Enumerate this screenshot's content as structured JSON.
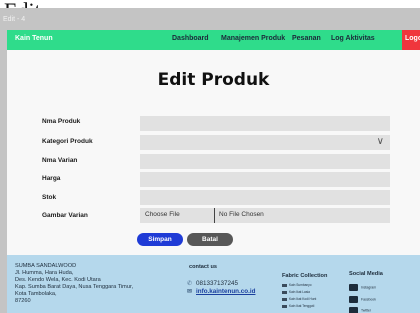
{
  "window": {
    "title": "Edit",
    "frame_label": "Edit - 4"
  },
  "navbar": {
    "brand": "Kain Tenun",
    "items": [
      {
        "label": "Dashboard"
      },
      {
        "label": "Manajemen Produk"
      },
      {
        "label": "Pesanan"
      },
      {
        "label": "Log Aktivitas"
      }
    ],
    "logout": "Logout",
    "accent": "#2fdc8b"
  },
  "page": {
    "title": "Edit Produk",
    "fields": [
      {
        "label": "Nma Produk",
        "value": ""
      },
      {
        "label": "Kategori Produk",
        "value": ""
      },
      {
        "label": "Nma Varian",
        "value": ""
      },
      {
        "label": "Harga",
        "value": ""
      },
      {
        "label": "Stok",
        "value": ""
      }
    ],
    "variant_image": {
      "label": "Gambar Varian",
      "button": "Choose File",
      "filename": "No File Chosen"
    },
    "save_label": "Simpan",
    "cancel_label": "Batal"
  },
  "footer": {
    "address": [
      "SUMBA SANDALWOOD",
      "Jl. Humma, Hara Huda,",
      "Des. Kendo Wela, Kec. Kodi Utara",
      "Kap. Sumba Barat Daya, Nusa Tenggara Timur,",
      "Kota Tambolaka,",
      "87260"
    ],
    "contact_title": "contact us",
    "phone": "081337137245",
    "email": "info.kaintenun.co.id",
    "fabric_title": "Fabric Collection",
    "fabric_items": [
      "Kain Sumbanyo",
      "Kain Ikat Lasia",
      "Kain Ikat Kodi Hunt",
      "Kain Ikat Tenggoti"
    ],
    "social_title": "Social Media",
    "social_items": [
      "Instagram",
      "Facebook",
      "Twitter"
    ]
  }
}
